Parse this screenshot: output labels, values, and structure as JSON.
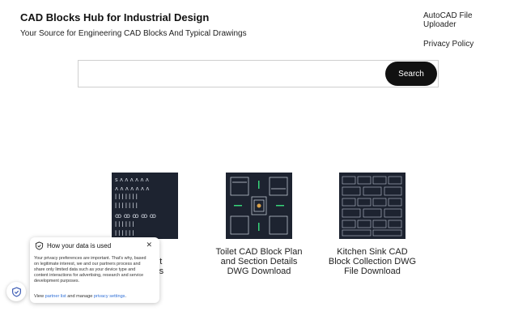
{
  "header": {
    "title": "CAD Blocks Hub for Industrial Design",
    "tagline": "Your Source for Engineering CAD Blocks And Typical Drawings",
    "nav": [
      "AutoCAD File Uploader",
      "Privacy Policy"
    ]
  },
  "search": {
    "value": "",
    "placeholder": "",
    "button_label": "Search"
  },
  "cards": [
    {
      "caption": ""
    },
    {
      "caption": "Toilet CAD Block Plan and Section Details DWG Download"
    },
    {
      "caption": "Kitchen Sink CAD Block Collection DWG File Download"
    }
  ],
  "partial_caption_lines": [
    "e",
    "ent",
    "ves",
    "G",
    "d"
  ],
  "privacy": {
    "title": "How your data is used",
    "body": "Your privacy preferences are important. That's why, based on legitimate interest, we and our partners process and share only limited data such as your device type and content interactions for advertising, research and service development purposes.",
    "foot_prefix": "View ",
    "partner_link": "partner list",
    "foot_middle": " and manage ",
    "settings_link": "privacy settings",
    "foot_suffix": "."
  },
  "colors": {
    "thumb_bg": "#1d2330",
    "link": "#2f6fd6",
    "button": "#111111"
  }
}
